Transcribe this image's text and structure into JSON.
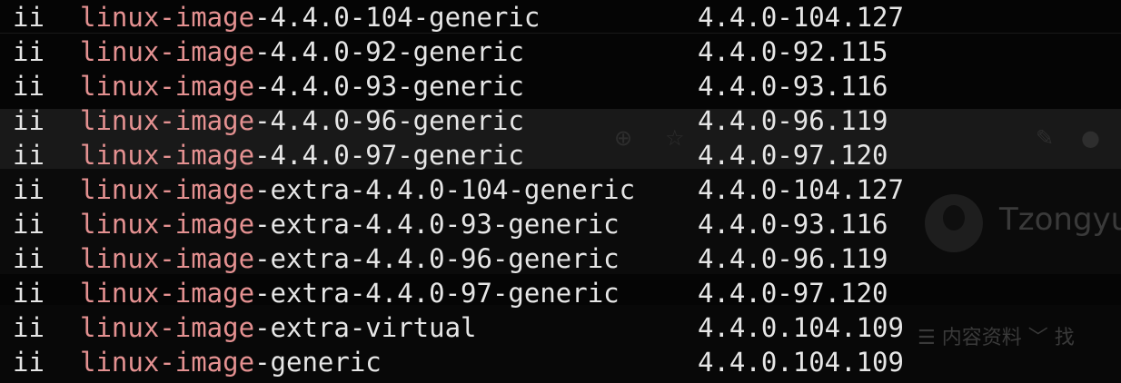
{
  "background_ui": {
    "profile_name": "Tzongyul",
    "menu_label": "☰ 内容资料 ﹀ 找"
  },
  "colors": {
    "terminal_bg": "#050505",
    "text": "#e6e6e6",
    "highlight": "#e49191"
  },
  "rows": [
    {
      "status": "ii",
      "prefix": "linux-image",
      "rest": "-4.4.0-104-generic",
      "version": "4.4.0-104.127"
    },
    {
      "status": "ii",
      "prefix": "linux-image",
      "rest": "-4.4.0-92-generic",
      "version": "4.4.0-92.115"
    },
    {
      "status": "ii",
      "prefix": "linux-image",
      "rest": "-4.4.0-93-generic",
      "version": "4.4.0-93.116"
    },
    {
      "status": "ii",
      "prefix": "linux-image",
      "rest": "-4.4.0-96-generic",
      "version": "4.4.0-96.119"
    },
    {
      "status": "ii",
      "prefix": "linux-image",
      "rest": "-4.4.0-97-generic",
      "version": "4.4.0-97.120"
    },
    {
      "status": "ii",
      "prefix": "linux-image",
      "rest": "-extra-4.4.0-104-generic",
      "version": "4.4.0-104.127"
    },
    {
      "status": "ii",
      "prefix": "linux-image",
      "rest": "-extra-4.4.0-93-generic",
      "version": "4.4.0-93.116"
    },
    {
      "status": "ii",
      "prefix": "linux-image",
      "rest": "-extra-4.4.0-96-generic",
      "version": "4.4.0-96.119"
    },
    {
      "status": "ii",
      "prefix": "linux-image",
      "rest": "-extra-4.4.0-97-generic",
      "version": "4.4.0-97.120"
    },
    {
      "status": "ii",
      "prefix": "linux-image",
      "rest": "-extra-virtual",
      "version": "4.4.0.104.109"
    },
    {
      "status": "ii",
      "prefix": "linux-image",
      "rest": "-generic",
      "version": "4.4.0.104.109"
    }
  ]
}
